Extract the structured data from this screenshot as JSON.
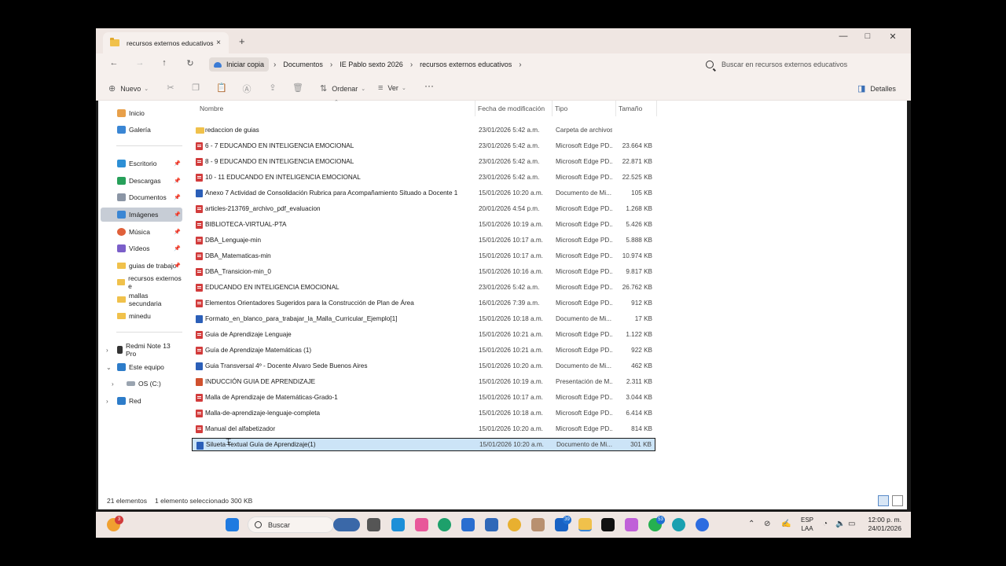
{
  "window": {
    "tab_title": "recursos externos educativos",
    "tab_close": "×",
    "new_tab": "+",
    "minimize": "—",
    "maximize": "□",
    "close": "✕"
  },
  "nav": {
    "back": "←",
    "forward": "→",
    "up": "↑",
    "refresh": "↻",
    "breadcrumb": [
      "Iniciar copia",
      "Documentos",
      "IE Pablo sexto 2026",
      "recursos externos educativos"
    ],
    "search_placeholder": "Buscar en recursos externos educativos"
  },
  "toolbar": {
    "new_label": "Nuevo",
    "sort_label": "Ordenar",
    "view_label": "Ver",
    "more_label": "···",
    "details_label": "Detalles"
  },
  "sidebar": {
    "home": "Inicio",
    "gallery": "Galería",
    "quick": [
      "Escritorio",
      "Descargas",
      "Documentos",
      "Imágenes",
      "Música",
      "Vídeos",
      "guias de trabajo",
      "recursos externos e",
      "mallas secundaria",
      "minedu"
    ],
    "devices": [
      "Redmi Note 13 Pro",
      "Este equipo",
      "OS (C:)",
      "Red"
    ]
  },
  "columns": {
    "name": "Nombre",
    "date": "Fecha de modificación",
    "type": "Tipo",
    "size": "Tamaño"
  },
  "files": [
    {
      "name": "redaccion de guias",
      "date": "23/01/2026 5:42 a.m.",
      "type": "Carpeta de archivos",
      "size": "",
      "icon": "folder"
    },
    {
      "name": "6 - 7 EDUCANDO EN INTELIGENCIA EMOCIONAL",
      "date": "23/01/2026 5:42 a.m.",
      "type": "Microsoft Edge PD...",
      "size": "23.664 KB",
      "icon": "pdf"
    },
    {
      "name": "8 - 9 EDUCANDO EN INTELIGENCIA EMOCIONAL",
      "date": "23/01/2026 5:42 a.m.",
      "type": "Microsoft Edge PD...",
      "size": "22.871 KB",
      "icon": "pdf"
    },
    {
      "name": "10 - 11 EDUCANDO EN INTELIGENCIA EMOCIONAL",
      "date": "23/01/2026 5:42 a.m.",
      "type": "Microsoft Edge PD...",
      "size": "22.525 KB",
      "icon": "pdf"
    },
    {
      "name": "Anexo 7 Actividad de Consolidación Rubrica para Acompañamiento Situado a Docente 1",
      "date": "15/01/2026 10:20 a.m.",
      "type": "Documento de Mi...",
      "size": "105 KB",
      "icon": "word"
    },
    {
      "name": "articles-213769_archivo_pdf_evaluacion",
      "date": "20/01/2026 4:54 p.m.",
      "type": "Microsoft Edge PD...",
      "size": "1.268 KB",
      "icon": "pdf"
    },
    {
      "name": "BIBLIOTECA-VIRTUAL-PTA",
      "date": "15/01/2026 10:19 a.m.",
      "type": "Microsoft Edge PD...",
      "size": "5.426 KB",
      "icon": "pdf"
    },
    {
      "name": "DBA_Lenguaje-min",
      "date": "15/01/2026 10:17 a.m.",
      "type": "Microsoft Edge PD...",
      "size": "5.888 KB",
      "icon": "pdf"
    },
    {
      "name": "DBA_Matematicas-min",
      "date": "15/01/2026 10:17 a.m.",
      "type": "Microsoft Edge PD...",
      "size": "10.974 KB",
      "icon": "pdf"
    },
    {
      "name": "DBA_Transicion-min_0",
      "date": "15/01/2026 10:16 a.m.",
      "type": "Microsoft Edge PD...",
      "size": "9.817 KB",
      "icon": "pdf"
    },
    {
      "name": "EDUCANDO EN INTELIGENCIA EMOCIONAL",
      "date": "23/01/2026 5:42 a.m.",
      "type": "Microsoft Edge PD...",
      "size": "26.762 KB",
      "icon": "pdf"
    },
    {
      "name": "Elementos Orientadores Sugeridos para la Construcción de Plan de Área",
      "date": "16/01/2026 7:39 a.m.",
      "type": "Microsoft Edge PD...",
      "size": "912 KB",
      "icon": "pdf"
    },
    {
      "name": "Formato_en_blanco_para_trabajar_la_Malla_Curricular_Ejemplo[1]",
      "date": "15/01/2026 10:18 a.m.",
      "type": "Documento de Mi...",
      "size": "17 KB",
      "icon": "word"
    },
    {
      "name": "Guia de Aprendizaje Lenguaje",
      "date": "15/01/2026 10:21 a.m.",
      "type": "Microsoft Edge PD...",
      "size": "1.122 KB",
      "icon": "pdf"
    },
    {
      "name": "Guía de Aprendizaje Matemáticas (1)",
      "date": "15/01/2026 10:21 a.m.",
      "type": "Microsoft Edge PD...",
      "size": "922 KB",
      "icon": "pdf"
    },
    {
      "name": "Guia Transversal 4º - Docente Alvaro Sede Buenos Aires",
      "date": "15/01/2026 10:20 a.m.",
      "type": "Documento de Mi...",
      "size": "462 KB",
      "icon": "word"
    },
    {
      "name": "INDUCCIÓN GUIA DE APRENDIZAJE",
      "date": "15/01/2026 10:19 a.m.",
      "type": "Presentación de M...",
      "size": "2.311 KB",
      "icon": "ppt"
    },
    {
      "name": "Malla de Aprendizaje de Matemáticas-Grado-1",
      "date": "15/01/2026 10:17 a.m.",
      "type": "Microsoft Edge PD...",
      "size": "3.044 KB",
      "icon": "pdf"
    },
    {
      "name": "Malla-de-aprendizaje-lenguaje-completa",
      "date": "15/01/2026 10:18 a.m.",
      "type": "Microsoft Edge PD...",
      "size": "6.414 KB",
      "icon": "pdf"
    },
    {
      "name": "Manual del alfabetizador",
      "date": "15/01/2026 10:20 a.m.",
      "type": "Microsoft Edge PD...",
      "size": "814 KB",
      "icon": "pdf"
    },
    {
      "name": "Silueta Textual Guía de Aprendizaje(1)",
      "date": "15/01/2026 10:20 a.m.",
      "type": "Documento de Mi...",
      "size": "301 KB",
      "icon": "word",
      "selected": true
    }
  ],
  "status": {
    "count": "21 elementos",
    "selection": "1 elemento seleccionado  300 KB"
  },
  "taskbar": {
    "search_label": "Buscar",
    "weather_badge": "3",
    "mail_badge": "39",
    "whatsapp_badge": "53",
    "lang_top": "ESP",
    "lang_bottom": "LAA",
    "time": "12:00 p. m.",
    "date": "24/01/2026"
  }
}
